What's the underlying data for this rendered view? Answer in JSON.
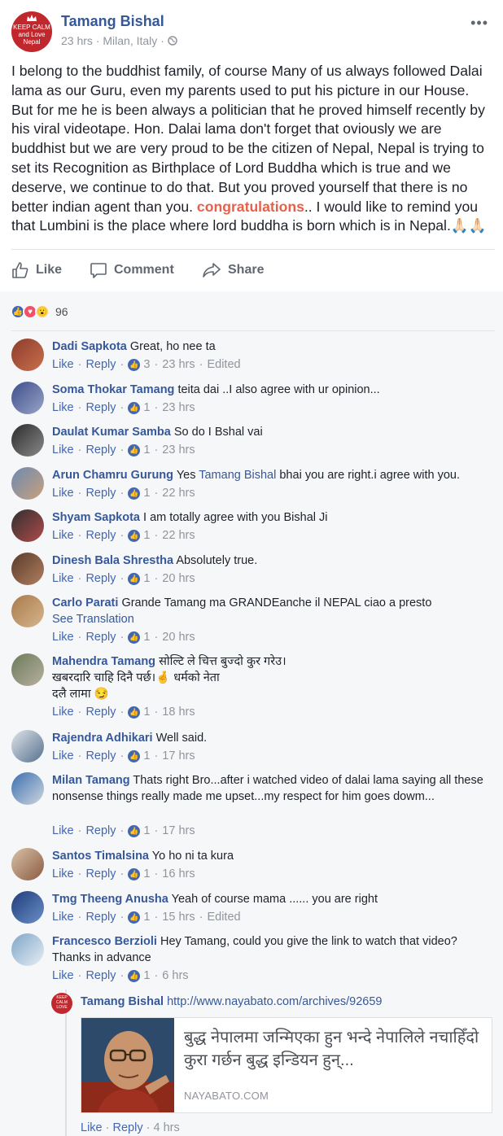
{
  "post": {
    "author": "Tamang Bishal",
    "avatar_text": "KEEP CALM and Love Nepal",
    "time": "23 hrs",
    "location": "Milan, Italy",
    "privacy_icon": "globe-icon",
    "text_before": "I belong to the buddhist family, of course Many of us always followed Dalai lama as our Guru, even my parents used to put his picture in our House. But for me he is been always a politician that he proved himself recently by his viral videotape. Hon. Dalai lama don't forget that oviously we are buddhist but we are very proud to be the citizen of Nepal, Nepal is trying to set its Recognition as Birthplace of Lord Buddha which is true and we deserve, we continue to do that. But you proved yourself that there is no better indian agent than you. ",
    "highlight": "congratulations",
    "text_after": ".. I would like to remind you that Lumbini is the place where lord buddha is born which is in Nepal.",
    "emoji": "🙏🏻🙏🏻"
  },
  "actions": {
    "like": "Like",
    "comment": "Comment",
    "share": "Share"
  },
  "reactions": {
    "count": "96"
  },
  "comments": [
    {
      "name": "Dadi Sapkota",
      "text": "Great, ho nee ta",
      "likes": "3",
      "time": "23 hrs",
      "edited": "Edited"
    },
    {
      "name": "Soma Thokar Tamang",
      "text": "teita dai ..I also agree with ur opinion...",
      "likes": "1",
      "time": "23 hrs"
    },
    {
      "name": "Daulat Kumar Samba",
      "text": "So do I Bshal vai",
      "likes": "1",
      "time": "23 hrs"
    },
    {
      "name": "Arun Chamru Gurung",
      "text_pre": "Yes ",
      "mention": "Tamang Bishal",
      "text": " bhai you are right.i agree with you.",
      "likes": "1",
      "time": "22 hrs"
    },
    {
      "name": "Shyam Sapkota",
      "text": "I am totally agree with you Bishal Ji",
      "likes": "1",
      "time": "22 hrs"
    },
    {
      "name": "Dinesh Bala Shrestha",
      "text": "Absolutely true.",
      "likes": "1",
      "time": "20 hrs"
    },
    {
      "name": "Carlo Parati",
      "text": "Grande Tamang ma GRANDEanche il NEPAL ciao a presto",
      "translate": "See Translation",
      "likes": "1",
      "time": "20 hrs"
    },
    {
      "name": "Mahendra Tamang",
      "text": "सोल्टि ले चित्त बुज्दो कुर गरेउ।",
      "line2": "खबरदारि चाहि दिनै पर्छ।",
      "line2_emoji": "🤞",
      "line2_after": "धर्मको नेता",
      "line3": "दलै लामा",
      "line3_emoji": "😏",
      "likes": "1",
      "time": "18 hrs"
    },
    {
      "name": "Rajendra Adhikari",
      "text": "Well said.",
      "likes": "1",
      "time": "17 hrs"
    },
    {
      "name": "Milan Tamang",
      "text": "Thats right Bro...after i watched video of dalai lama saying all these nonsense things really made me upset...my respect for him goes dowm...",
      "likes": "1",
      "time": "17 hrs"
    },
    {
      "name": "Santos Timalsina",
      "text": "Yo ho ni ta kura",
      "likes": "1",
      "time": "16 hrs"
    },
    {
      "name": "Tmg Theeng Anusha",
      "text": "Yeah of course mama ...... you are right",
      "likes": "1",
      "time": "15 hrs",
      "edited": "Edited"
    },
    {
      "name": "Francesco Berzioli",
      "text": "Hey Tamang, could you give the link to watch that video? Thanks in advance",
      "likes": "1",
      "time": "6 hrs"
    }
  ],
  "labels": {
    "like": "Like",
    "reply": "Reply"
  },
  "reply": {
    "name": "Tamang Bishal",
    "url": "http://www.nayabato.com/archives/92659",
    "preview_title": "बुद्ध नेपालमा जन्मिएका हुन भन्दे नेपालिले नचाहिँदो कुरा गर्छन बुद्ध इन्डियन हुन्...",
    "preview_site": "NAYABATO.COM",
    "time": "4 hrs"
  },
  "colors": {
    "link": "#365899",
    "highlight": "#e9604a",
    "meta": "#90949c",
    "bg_comments": "#f6f7f9"
  }
}
